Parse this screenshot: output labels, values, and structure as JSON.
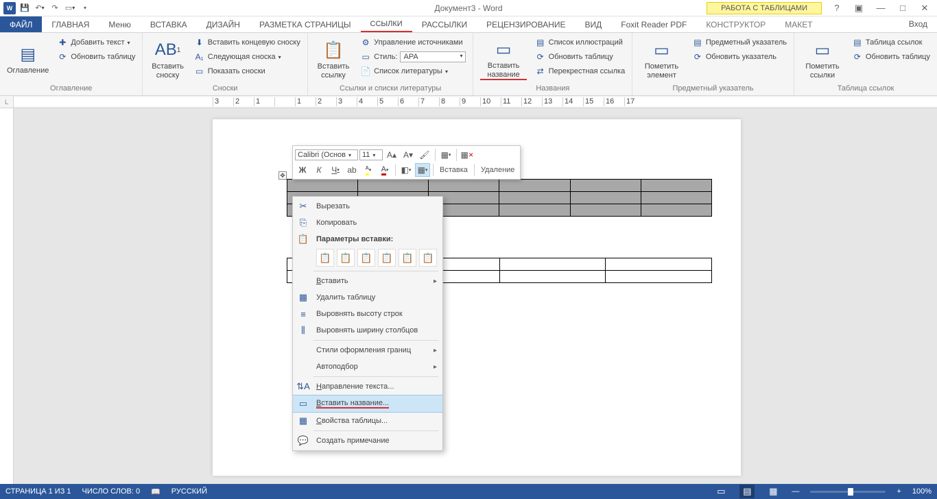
{
  "title": "Документ3 - Word",
  "table_tools": "РАБОТА С ТАБЛИЦАМИ",
  "login": "Вход",
  "tabs": {
    "file": "ФАЙЛ",
    "home": "ГЛАВНАЯ",
    "menu": "Меню",
    "insert": "ВСТАВКА",
    "design": "ДИЗАЙН",
    "layout": "РАЗМЕТКА СТРАНИЦЫ",
    "references": "ССЫЛКИ",
    "mailings": "РАССЫЛКИ",
    "review": "РЕЦЕНЗИРОВАНИЕ",
    "view": "ВИД",
    "foxit": "Foxit Reader PDF",
    "constructor": "КОНСТРУКТОР",
    "maket": "МАКЕТ"
  },
  "ribbon": {
    "toc": {
      "big": "Оглавление",
      "add_text": "Добавить текст",
      "update": "Обновить таблицу",
      "group": "Оглавление"
    },
    "footnotes": {
      "big": "Вставить сноску",
      "end": "Вставить концевую сноску",
      "next": "Следующая сноска",
      "show": "Показать сноски",
      "group": "Сноски"
    },
    "citations": {
      "big": "Вставить ссылку",
      "manage": "Управление источниками",
      "style_label": "Стиль:",
      "style_value": "APA",
      "biblio": "Список литературы",
      "group": "Ссылки и списки литературы"
    },
    "captions": {
      "big": "Вставить название",
      "figures": "Список иллюстраций",
      "update": "Обновить таблицу",
      "cross": "Перекрестная ссылка",
      "group": "Названия"
    },
    "index": {
      "big": "Пометить элемент",
      "index": "Предметный указатель",
      "update": "Обновить указатель",
      "group": "Предметный указатель"
    },
    "toa": {
      "big": "Пометить ссылки",
      "list": "Таблица ссылок",
      "update": "Обновить таблицу",
      "group": "Таблица ссылок"
    }
  },
  "ruler": [
    "3",
    "2",
    "1",
    "",
    "1",
    "2",
    "3",
    "4",
    "5",
    "6",
    "7",
    "8",
    "9",
    "10",
    "11",
    "12",
    "13",
    "14",
    "15",
    "16",
    "17"
  ],
  "mini": {
    "font": "Calibri (Основ",
    "size": "11",
    "insert": "Вставка",
    "delete": "Удаление"
  },
  "context": {
    "cut": "Вырезать",
    "copy": "Копировать",
    "paste_header": "Параметры вставки:",
    "insert": "Вставить",
    "delete_table": "Удалить таблицу",
    "dist_rows": "Выровнять высоту строк",
    "dist_cols": "Выровнять ширину столбцов",
    "border_styles": "Стили оформления границ",
    "autofit": "Автоподбор",
    "text_dir": "Направление текста...",
    "insert_caption": "Вставить название...",
    "table_props": "Свойства таблицы...",
    "new_comment": "Создать примечание"
  },
  "status": {
    "page": "СТРАНИЦА 1 ИЗ 1",
    "words": "ЧИСЛО СЛОВ: 0",
    "lang": "РУССКИЙ",
    "zoom": "100%"
  }
}
